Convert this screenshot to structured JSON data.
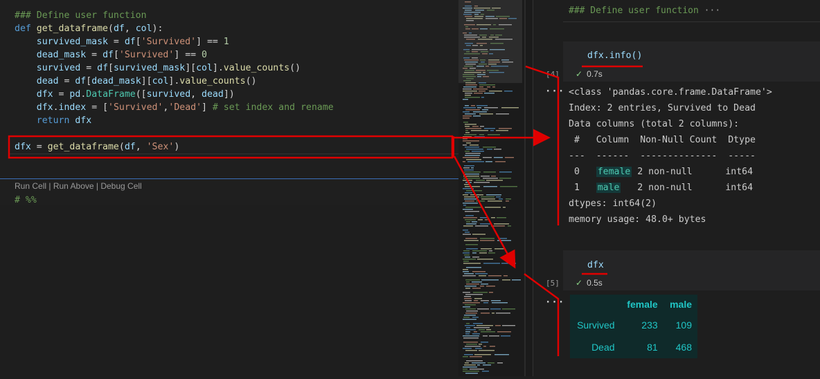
{
  "editor": {
    "lines": [
      {
        "tokens": [
          {
            "c": "cmt",
            "t": "### Define user function"
          }
        ]
      },
      {
        "tokens": [
          {
            "c": "kw",
            "t": "def "
          },
          {
            "c": "fn",
            "t": "get_dataframe"
          },
          {
            "c": "plain",
            "t": "("
          },
          {
            "c": "var",
            "t": "df"
          },
          {
            "c": "plain",
            "t": ", "
          },
          {
            "c": "var",
            "t": "col"
          },
          {
            "c": "plain",
            "t": "):"
          }
        ]
      },
      {
        "tokens": [
          {
            "c": "plain",
            "t": "    "
          },
          {
            "c": "var",
            "t": "survived_mask"
          },
          {
            "c": "plain",
            "t": " = "
          },
          {
            "c": "var",
            "t": "df"
          },
          {
            "c": "plain",
            "t": "["
          },
          {
            "c": "str",
            "t": "'Survived'"
          },
          {
            "c": "plain",
            "t": "] == "
          },
          {
            "c": "num",
            "t": "1"
          }
        ]
      },
      {
        "tokens": [
          {
            "c": "plain",
            "t": "    "
          },
          {
            "c": "var",
            "t": "dead_mask"
          },
          {
            "c": "plain",
            "t": " = "
          },
          {
            "c": "var",
            "t": "df"
          },
          {
            "c": "plain",
            "t": "["
          },
          {
            "c": "str",
            "t": "'Survived'"
          },
          {
            "c": "plain",
            "t": "] == "
          },
          {
            "c": "num",
            "t": "0"
          }
        ]
      },
      {
        "tokens": [
          {
            "c": "plain",
            "t": "    "
          },
          {
            "c": "var",
            "t": "survived"
          },
          {
            "c": "plain",
            "t": " = "
          },
          {
            "c": "var",
            "t": "df"
          },
          {
            "c": "plain",
            "t": "["
          },
          {
            "c": "var",
            "t": "survived_mask"
          },
          {
            "c": "plain",
            "t": "]["
          },
          {
            "c": "var",
            "t": "col"
          },
          {
            "c": "plain",
            "t": "]."
          },
          {
            "c": "fn",
            "t": "value_counts"
          },
          {
            "c": "plain",
            "t": "()"
          }
        ]
      },
      {
        "tokens": [
          {
            "c": "plain",
            "t": "    "
          },
          {
            "c": "var",
            "t": "dead"
          },
          {
            "c": "plain",
            "t": " = "
          },
          {
            "c": "var",
            "t": "df"
          },
          {
            "c": "plain",
            "t": "["
          },
          {
            "c": "var",
            "t": "dead_mask"
          },
          {
            "c": "plain",
            "t": "]["
          },
          {
            "c": "var",
            "t": "col"
          },
          {
            "c": "plain",
            "t": "]."
          },
          {
            "c": "fn",
            "t": "value_counts"
          },
          {
            "c": "plain",
            "t": "()"
          }
        ]
      },
      {
        "tokens": [
          {
            "c": "plain",
            "t": "    "
          },
          {
            "c": "var",
            "t": "dfx"
          },
          {
            "c": "plain",
            "t": " = "
          },
          {
            "c": "var",
            "t": "pd"
          },
          {
            "c": "plain",
            "t": "."
          },
          {
            "c": "cls",
            "t": "DataFrame"
          },
          {
            "c": "plain",
            "t": "(["
          },
          {
            "c": "var",
            "t": "survived"
          },
          {
            "c": "plain",
            "t": ", "
          },
          {
            "c": "var",
            "t": "dead"
          },
          {
            "c": "plain",
            "t": "])"
          }
        ]
      },
      {
        "tokens": [
          {
            "c": "plain",
            "t": "    "
          },
          {
            "c": "var",
            "t": "dfx"
          },
          {
            "c": "plain",
            "t": "."
          },
          {
            "c": "var",
            "t": "index"
          },
          {
            "c": "plain",
            "t": " = ["
          },
          {
            "c": "str",
            "t": "'Survived'"
          },
          {
            "c": "plain",
            "t": ","
          },
          {
            "c": "str",
            "t": "'Dead'"
          },
          {
            "c": "plain",
            "t": "] "
          },
          {
            "c": "cmt",
            "t": "# set index and rename"
          }
        ]
      },
      {
        "tokens": [
          {
            "c": "plain",
            "t": "    "
          },
          {
            "c": "kw",
            "t": "return "
          },
          {
            "c": "var",
            "t": "dfx"
          }
        ]
      },
      {
        "tokens": []
      },
      {
        "tokens": [
          {
            "c": "var",
            "t": "dfx"
          },
          {
            "c": "plain",
            "t": " = "
          },
          {
            "c": "fn",
            "t": "get_dataframe"
          },
          {
            "c": "plain",
            "t": "("
          },
          {
            "c": "var",
            "t": "df"
          },
          {
            "c": "plain",
            "t": ", "
          },
          {
            "c": "str",
            "t": "'Sex'"
          },
          {
            "c": "plain",
            "t": ")"
          }
        ]
      }
    ],
    "code_lens": {
      "run_cell": "Run Cell",
      "sep1": " | ",
      "run_above": "Run Above",
      "sep2": " | ",
      "debug_cell": "Debug Cell"
    },
    "next_cell_marker": "# %%"
  },
  "notebook": {
    "markdown_heading": "### Define user function",
    "markdown_ellipsis": "···",
    "cell4": {
      "source": "dfx.info()",
      "count": "[4]",
      "time": "0.7s",
      "check": "✓",
      "more": "···"
    },
    "info_output": {
      "l1": "<class 'pandas.core.frame.DataFrame'>",
      "l2": "Index: 2 entries, Survived to Dead",
      "l3": "Data columns (total 2 columns):",
      "hdr": " #   Column  Non-Null Count  Dtype",
      "dash": "---  ------  --------------  -----",
      "r0_num": " 0   ",
      "r0_col": "female",
      "r0_rest": " 2 non-null      int64",
      "r1_num": " 1   ",
      "r1_col": "male",
      "r1_rest": "   2 non-null      int64",
      "dtypes": "dtypes: int64(2)",
      "mem": "memory usage: 48.0+ bytes"
    },
    "cell5": {
      "source": "dfx",
      "count": "[5]",
      "time": "0.5s",
      "check": "✓",
      "more": "···"
    },
    "table": {
      "columns": [
        "female",
        "male"
      ],
      "rows": [
        {
          "index": "Survived",
          "female": "233",
          "male": "109"
        },
        {
          "index": "Dead",
          "female": "81",
          "male": "468"
        }
      ]
    }
  },
  "colors": {
    "annotation": "#e00000",
    "accent": "#3b6fb8",
    "success": "#89d185",
    "teal": "#20c6c6"
  }
}
